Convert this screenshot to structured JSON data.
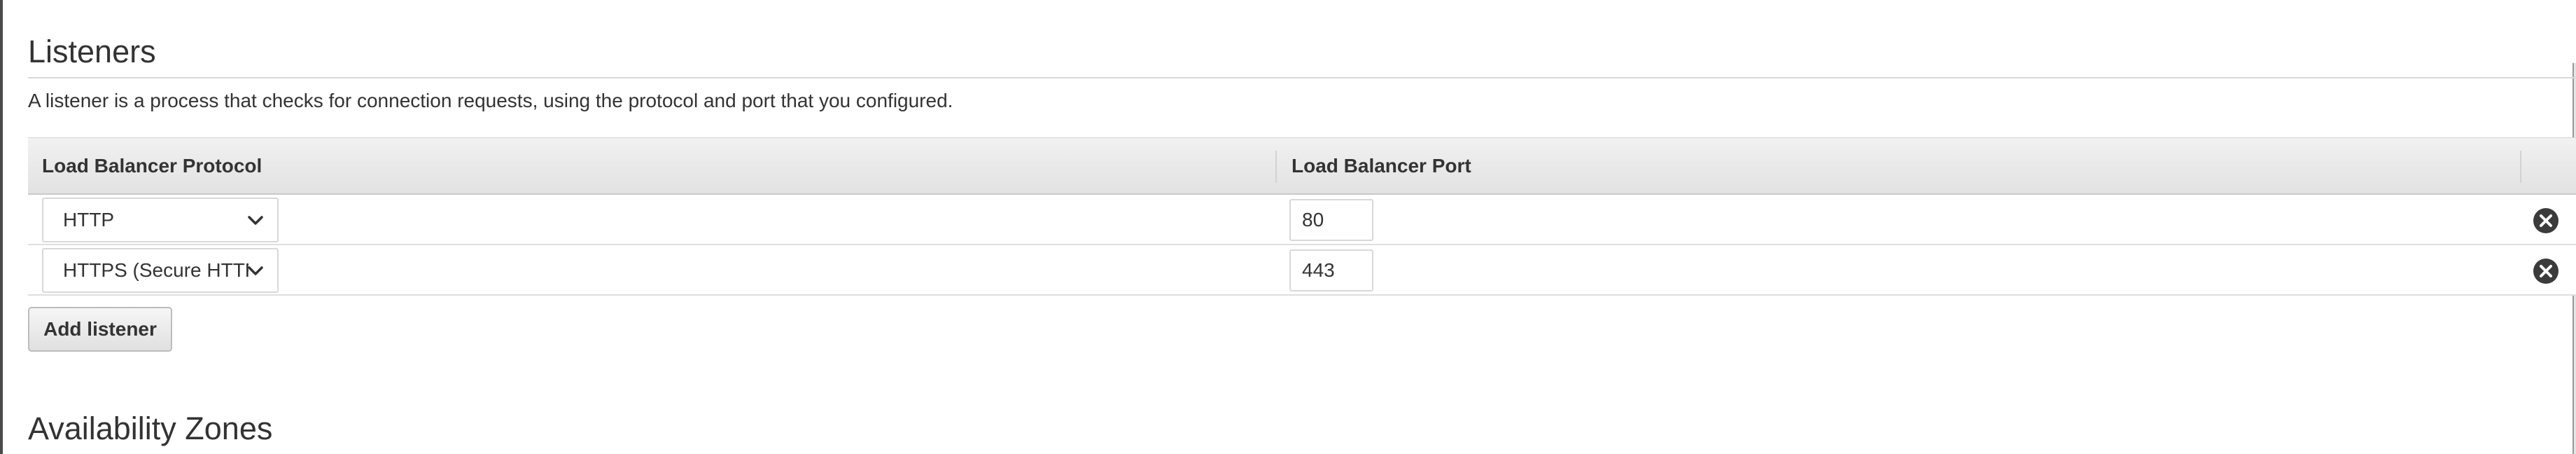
{
  "listeners": {
    "title": "Listeners",
    "description": "A listener is a process that checks for connection requests, using the protocol and port that you configured.",
    "columns": {
      "protocol": "Load Balancer Protocol",
      "port": "Load Balancer Port"
    },
    "rows": [
      {
        "protocol": "HTTP",
        "port": "80",
        "remove_icon": "close-circle-icon"
      },
      {
        "protocol": "HTTPS (Secure HTTP)",
        "port": "443",
        "remove_icon": "close-circle-icon"
      }
    ],
    "add_button_label": "Add listener"
  },
  "availability_zones": {
    "title": "Availability Zones"
  }
}
